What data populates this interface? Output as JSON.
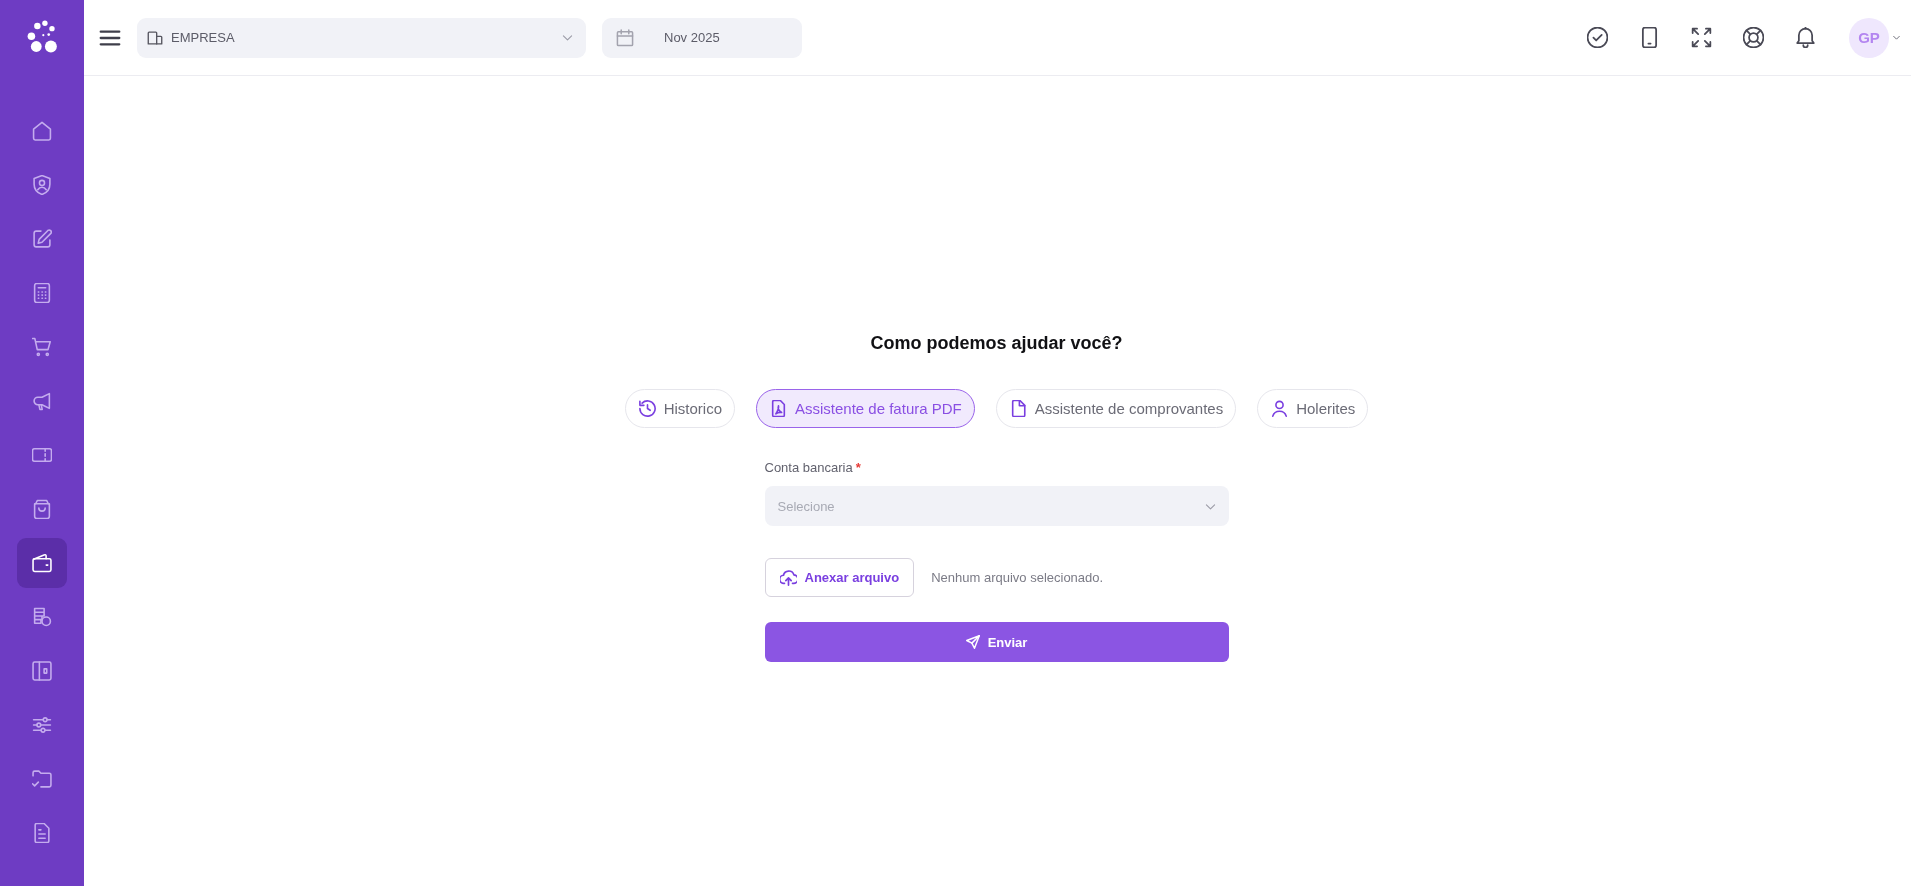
{
  "sidebar": {
    "items": [
      {
        "selected": false
      },
      {
        "selected": false
      },
      {
        "selected": false
      },
      {
        "selected": false
      },
      {
        "selected": false
      },
      {
        "selected": false
      },
      {
        "selected": false
      },
      {
        "selected": false
      },
      {
        "selected": true
      },
      {
        "selected": false
      },
      {
        "selected": false
      },
      {
        "selected": false
      },
      {
        "selected": false
      },
      {
        "selected": false
      }
    ]
  },
  "topbar": {
    "company_select": {
      "value": "EMPRESA"
    },
    "period_field": {
      "value": "Nov 2025"
    },
    "avatar": {
      "initials": "GP"
    }
  },
  "main": {
    "heading": "Como podemos ajudar você?",
    "tabs": [
      {
        "label": "Historico",
        "selected": false
      },
      {
        "label": "Assistente de fatura PDF",
        "selected": true
      },
      {
        "label": "Assistente de comprovantes",
        "selected": false
      },
      {
        "label": "Holerites",
        "selected": false
      }
    ],
    "form": {
      "bank_account": {
        "label": "Conta bancaria",
        "required_mark": "*",
        "placeholder": "Selecione"
      },
      "attach_button": "Anexar arquivo",
      "file_status": "Nenhum arquivo selecionado.",
      "submit_button": "Enviar"
    }
  }
}
